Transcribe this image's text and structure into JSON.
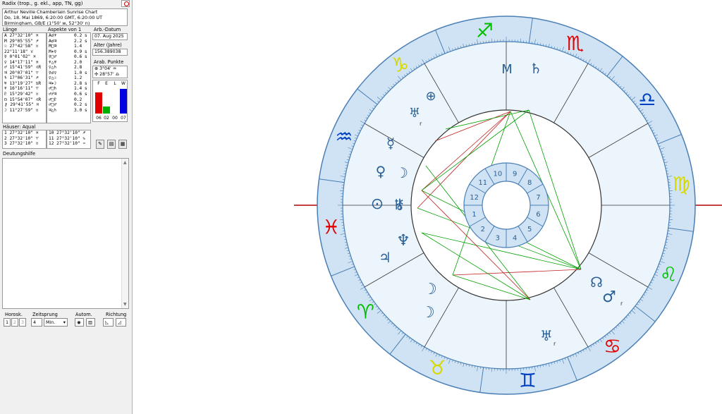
{
  "title": "Radix (trop., g. ekl., app, TN, gg)",
  "info": [
    "Arthur Neville Chamberlain Sunrise Chart",
    "Do, 18. Mai 1869, 6:20:00 GMT, 6:20:00 UT",
    "Birmingham, GB/E (1°50' w, 52°30' n)"
  ],
  "labels": {
    "laenge": "Länge",
    "aspekte": "Aspekte von 1",
    "arb_datum": "Arb.-Datum",
    "alter": "Alter (Jahre)",
    "arab_punkte": "Arab. Punkte",
    "haeuser": "Häuser: Aqual",
    "deutungshilfe": "Deutungshilfe",
    "horosk": "Horosk.",
    "zeitsprung": "Zeitsprung",
    "autom": "Autom.",
    "richtung": "Richtung"
  },
  "arb_datum_value": "07. Aug 2025",
  "alter_value": "156.389038",
  "arab_points": [
    "⊕ 3°04' ♒",
    "✣ 28°57' ♎"
  ],
  "positions": [
    "A  27°32'10\" ♓",
    "M 29°05'55\" ♐",
    "☉ 27°42'58\" ♉",
    "  22°11'18\" ♉",
    "☿  0°01'02\" ♓",
    "♀ 14°17'11\" ♓",
    "♂ 15°41'59\" ♌R",
    "♃ 20°07'01\" ♈",
    "♄ 17°06'31\" ♐",
    "♅ 13°19'27\" ♋R",
    "♆ 16°16'11\" ♈",
    "♇ 15°29'42\" ♉",
    "☊ 15°54'07\" ♌R",
    "⚷ 29°41'55\" ♓",
    "☽ 11°27'59\" ♉"
  ],
  "aspects": [
    [
      "A☌♆",
      "0.2 s"
    ],
    [
      "A☌♃",
      "2.2 s"
    ],
    [
      "M□♃",
      "1.4"
    ],
    [
      "M✶☿",
      "0.9 s"
    ],
    [
      "☿□♂",
      "0.6 s"
    ],
    [
      "♆△♅",
      "2.0"
    ],
    [
      "♀△♄",
      "2.8"
    ],
    [
      "☿☌♀",
      "1.0 s"
    ],
    [
      "♀△☉",
      "1.2"
    ],
    [
      "♃✶☽",
      "2.8 s"
    ],
    [
      "♂□♄",
      "1.4 s"
    ],
    [
      "♂☍♃",
      "0.6 s"
    ],
    [
      "♂□♇",
      "0.2"
    ],
    [
      "♂□♂",
      "0.2 s"
    ],
    [
      "♃△♄",
      "3.0 s"
    ]
  ],
  "elements": {
    "headers": [
      "F",
      "E",
      "L",
      "W"
    ],
    "counts": [
      "06",
      "02",
      "00",
      "07"
    ],
    "values": [
      6,
      2,
      0,
      7
    ],
    "colors": [
      "#e00000",
      "#00b000",
      "#c8c800",
      "#0000e0"
    ]
  },
  "houses_list": [
    "1  27°32'10\" ♓",
    "2  27°32'10\" ♈",
    "3  27°32'10\" ♉",
    "10 27°32'10\" ♐",
    "11 27°32'10\" ♑",
    "12 27°32'10\" ♒"
  ],
  "controls": {
    "horosk_values": [
      "1",
      "2",
      "3"
    ],
    "zeitsprung_value": "4",
    "unit": "Min."
  },
  "chart": {
    "angle_labels": [
      "M"
    ],
    "signs_colors": {
      "fire": "#e00000",
      "earth": "#00c000",
      "air": "#d8d800",
      "water": "#0040c0"
    },
    "zodiac_glyphs": [
      "♈",
      "♉",
      "♊",
      "♋",
      "♌",
      "♍",
      "♎",
      "♏",
      "♐",
      "♑",
      "♒",
      "♓"
    ],
    "house_numbers": [
      "1",
      "2",
      "3",
      "4",
      "5",
      "6",
      "7",
      "8",
      "9",
      "10",
      "11",
      "12"
    ],
    "planet_glyphs": {
      "asc": "⊙",
      "saturn": "♄",
      "mc": "M",
      "earth": "⊕",
      "uranus_node": "♅",
      "mercury": "☿",
      "venus": "♀",
      "moon": "☽",
      "chiron": "⚷",
      "neptune": "♆",
      "jupiter": "♃",
      "pluto": "♇",
      "sun2": "☽",
      "node": "☊",
      "mars": "♂",
      "uranus": "♅"
    },
    "retro_mark": "r"
  }
}
